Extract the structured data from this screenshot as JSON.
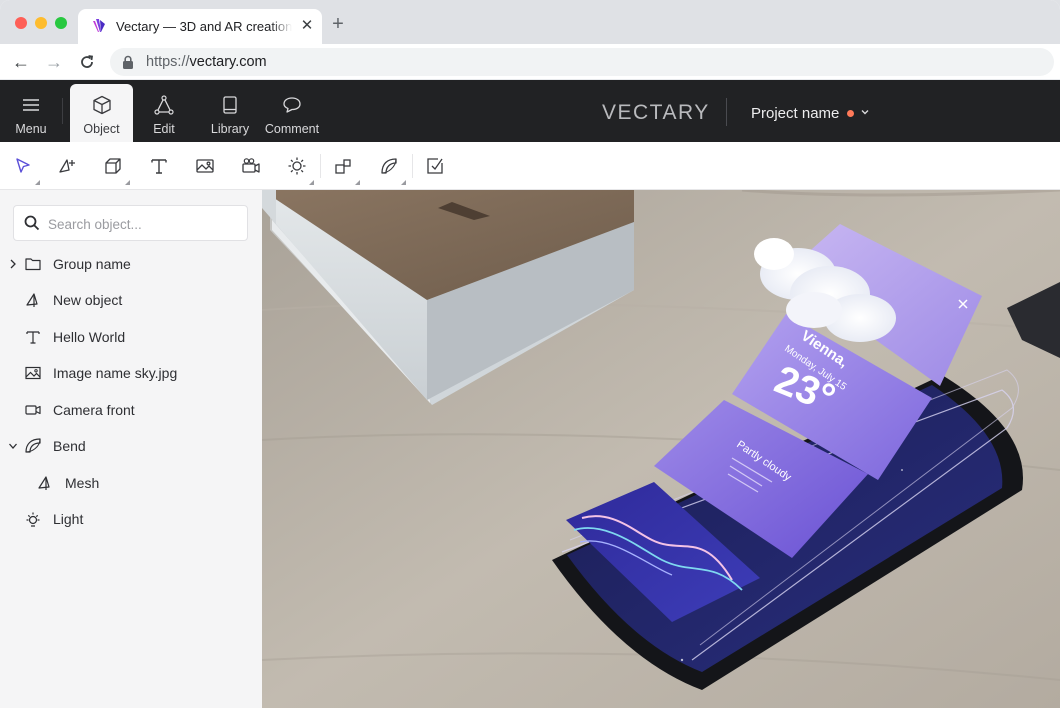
{
  "browser": {
    "tab_title": "Vectary — 3D and AR creation tool",
    "url_scheme": "https://",
    "url_host": "vectary.com"
  },
  "appbar": {
    "buttons": [
      {
        "label": "Menu",
        "icon": "hamburger-icon"
      },
      {
        "label": "Object",
        "icon": "cube-icon",
        "active": true
      },
      {
        "label": "Edit",
        "icon": "vertex-icon"
      },
      {
        "label": "Library",
        "icon": "book-icon"
      },
      {
        "label": "Comment",
        "icon": "speech-bubble-icon"
      }
    ],
    "brand": "VECTARY",
    "project_name": "Project name",
    "unsaved_indicator_color": "#ff7a59"
  },
  "toolbar": {
    "tools": [
      "select-arrow-icon",
      "add-point-icon",
      "cube-primitive-icon",
      "text-icon",
      "image-icon",
      "camera-icon",
      "light-icon",
      "group-icon",
      "deformer-icon",
      "export-icon"
    ],
    "accent": "#5b4fd8"
  },
  "sidebar": {
    "search_placeholder": "Search object...",
    "items": [
      {
        "label": "Group name",
        "icon": "folder-icon"
      },
      {
        "label": "New object",
        "icon": "mesh-icon"
      },
      {
        "label": "Hello World",
        "icon": "text-icon"
      },
      {
        "label": "Image name sky.jpg",
        "icon": "image-icon"
      },
      {
        "label": "Camera front",
        "icon": "camera-icon"
      },
      {
        "label": "Bend",
        "icon": "bend-icon"
      },
      {
        "label": "Mesh",
        "icon": "mesh-icon"
      },
      {
        "label": "Light",
        "icon": "light-icon"
      }
    ]
  },
  "scene": {
    "weather_card": {
      "city": "Vienna,",
      "date": "Monday, July 15",
      "temperature": "23°",
      "condition": "Partly cloudy"
    }
  }
}
